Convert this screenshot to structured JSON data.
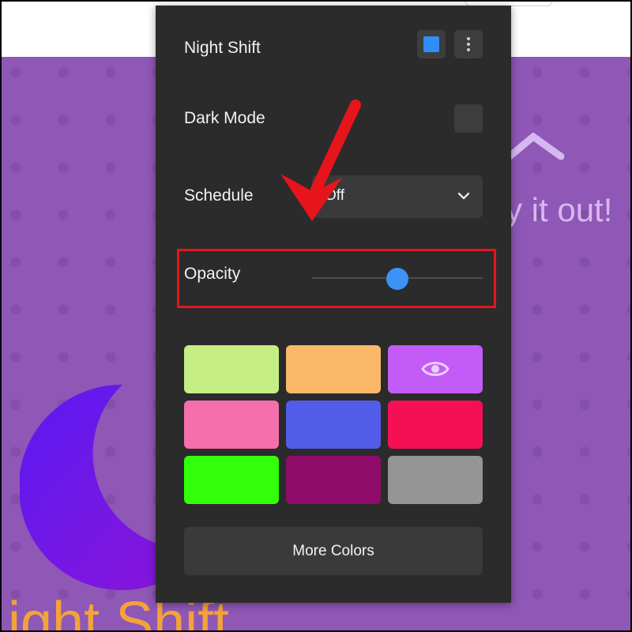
{
  "background": {
    "tagline": "y it out!",
    "title": "ight Shift",
    "colors": {
      "purple": "#8f57b6",
      "moon": "#6a17e8",
      "title": "#f2a33a"
    }
  },
  "panel": {
    "night_shift": {
      "label": "Night Shift",
      "accent": "#2f8ef4",
      "icon": "kebab-menu-icon"
    },
    "dark_mode": {
      "label": "Dark Mode"
    },
    "schedule": {
      "label": "Schedule",
      "value": "Off",
      "icon": "chevron-down-icon"
    },
    "opacity": {
      "label": "Opacity",
      "value_fraction": 0.5
    },
    "colors": [
      {
        "name": "light-green",
        "hex": "#c5ee85"
      },
      {
        "name": "orange",
        "hex": "#fbb869"
      },
      {
        "name": "violet",
        "hex": "#c35bf6",
        "selected": true,
        "icon": "eye-icon"
      },
      {
        "name": "pink",
        "hex": "#f46fab"
      },
      {
        "name": "blue",
        "hex": "#535ce8"
      },
      {
        "name": "crimson",
        "hex": "#f50f55"
      },
      {
        "name": "green",
        "hex": "#32ff0a"
      },
      {
        "name": "plum",
        "hex": "#8e0b6a"
      },
      {
        "name": "gray",
        "hex": "#959595"
      }
    ],
    "more_colors_label": "More Colors"
  },
  "annotation": {
    "color": "#e8141c"
  }
}
